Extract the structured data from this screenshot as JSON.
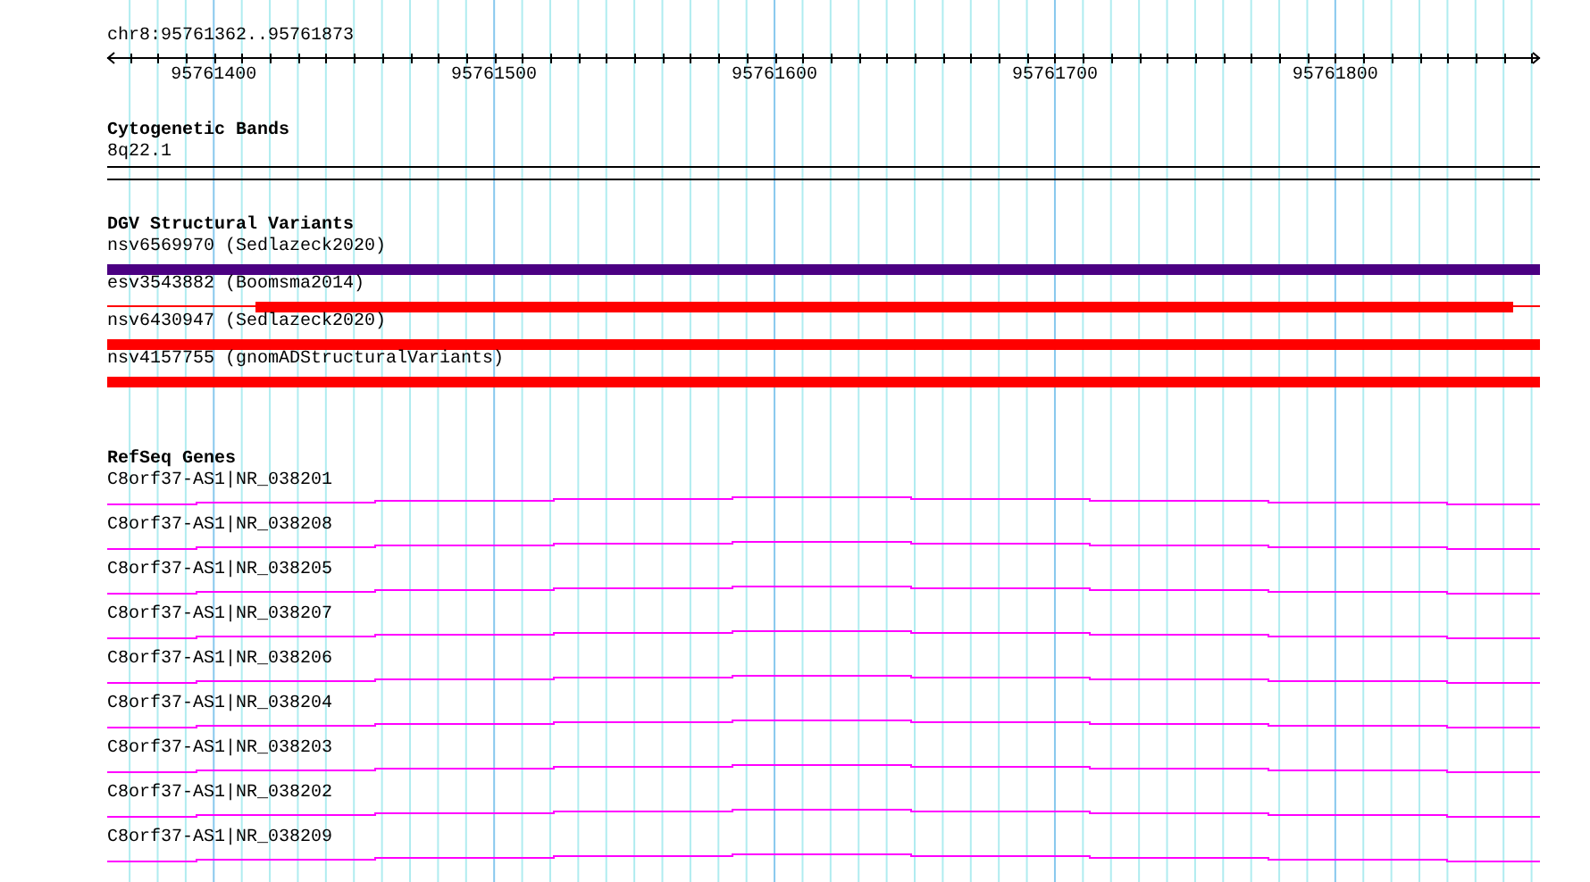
{
  "ruler": {
    "position": "chr8:95761362..95761873",
    "ticks": [
      "95761400",
      "95761500",
      "95761600",
      "95761700",
      "95761800"
    ]
  },
  "tracks": [
    {
      "kind": "cytoband",
      "title": "Cytogenetic Bands",
      "items": [
        {
          "label": "8q22.1"
        }
      ]
    },
    {
      "kind": "variants",
      "title": "DGV Structural Variants",
      "items": [
        {
          "label": "nsv6569970 (Sedlazeck2020)",
          "color": "#4b0082",
          "kind": "full"
        },
        {
          "label": "esv3543882 (Boomsma2014)",
          "color": "#ff0000",
          "kind": "partial"
        },
        {
          "label": "nsv6430947 (Sedlazeck2020)",
          "color": "#ff0000",
          "kind": "full"
        },
        {
          "label": "nsv4157755 (gnomADStructuralVariants)",
          "color": "#ff0000",
          "kind": "full"
        }
      ]
    },
    {
      "kind": "genes",
      "title": "RefSeq Genes",
      "items": [
        {
          "label": "C8orf37-AS1|NR_038201"
        },
        {
          "label": "C8orf37-AS1|NR_038208"
        },
        {
          "label": "C8orf37-AS1|NR_038205"
        },
        {
          "label": "C8orf37-AS1|NR_038207"
        },
        {
          "label": "C8orf37-AS1|NR_038206"
        },
        {
          "label": "C8orf37-AS1|NR_038204"
        },
        {
          "label": "C8orf37-AS1|NR_038203"
        },
        {
          "label": "C8orf37-AS1|NR_038202"
        },
        {
          "label": "C8orf37-AS1|NR_038209"
        }
      ]
    }
  ]
}
